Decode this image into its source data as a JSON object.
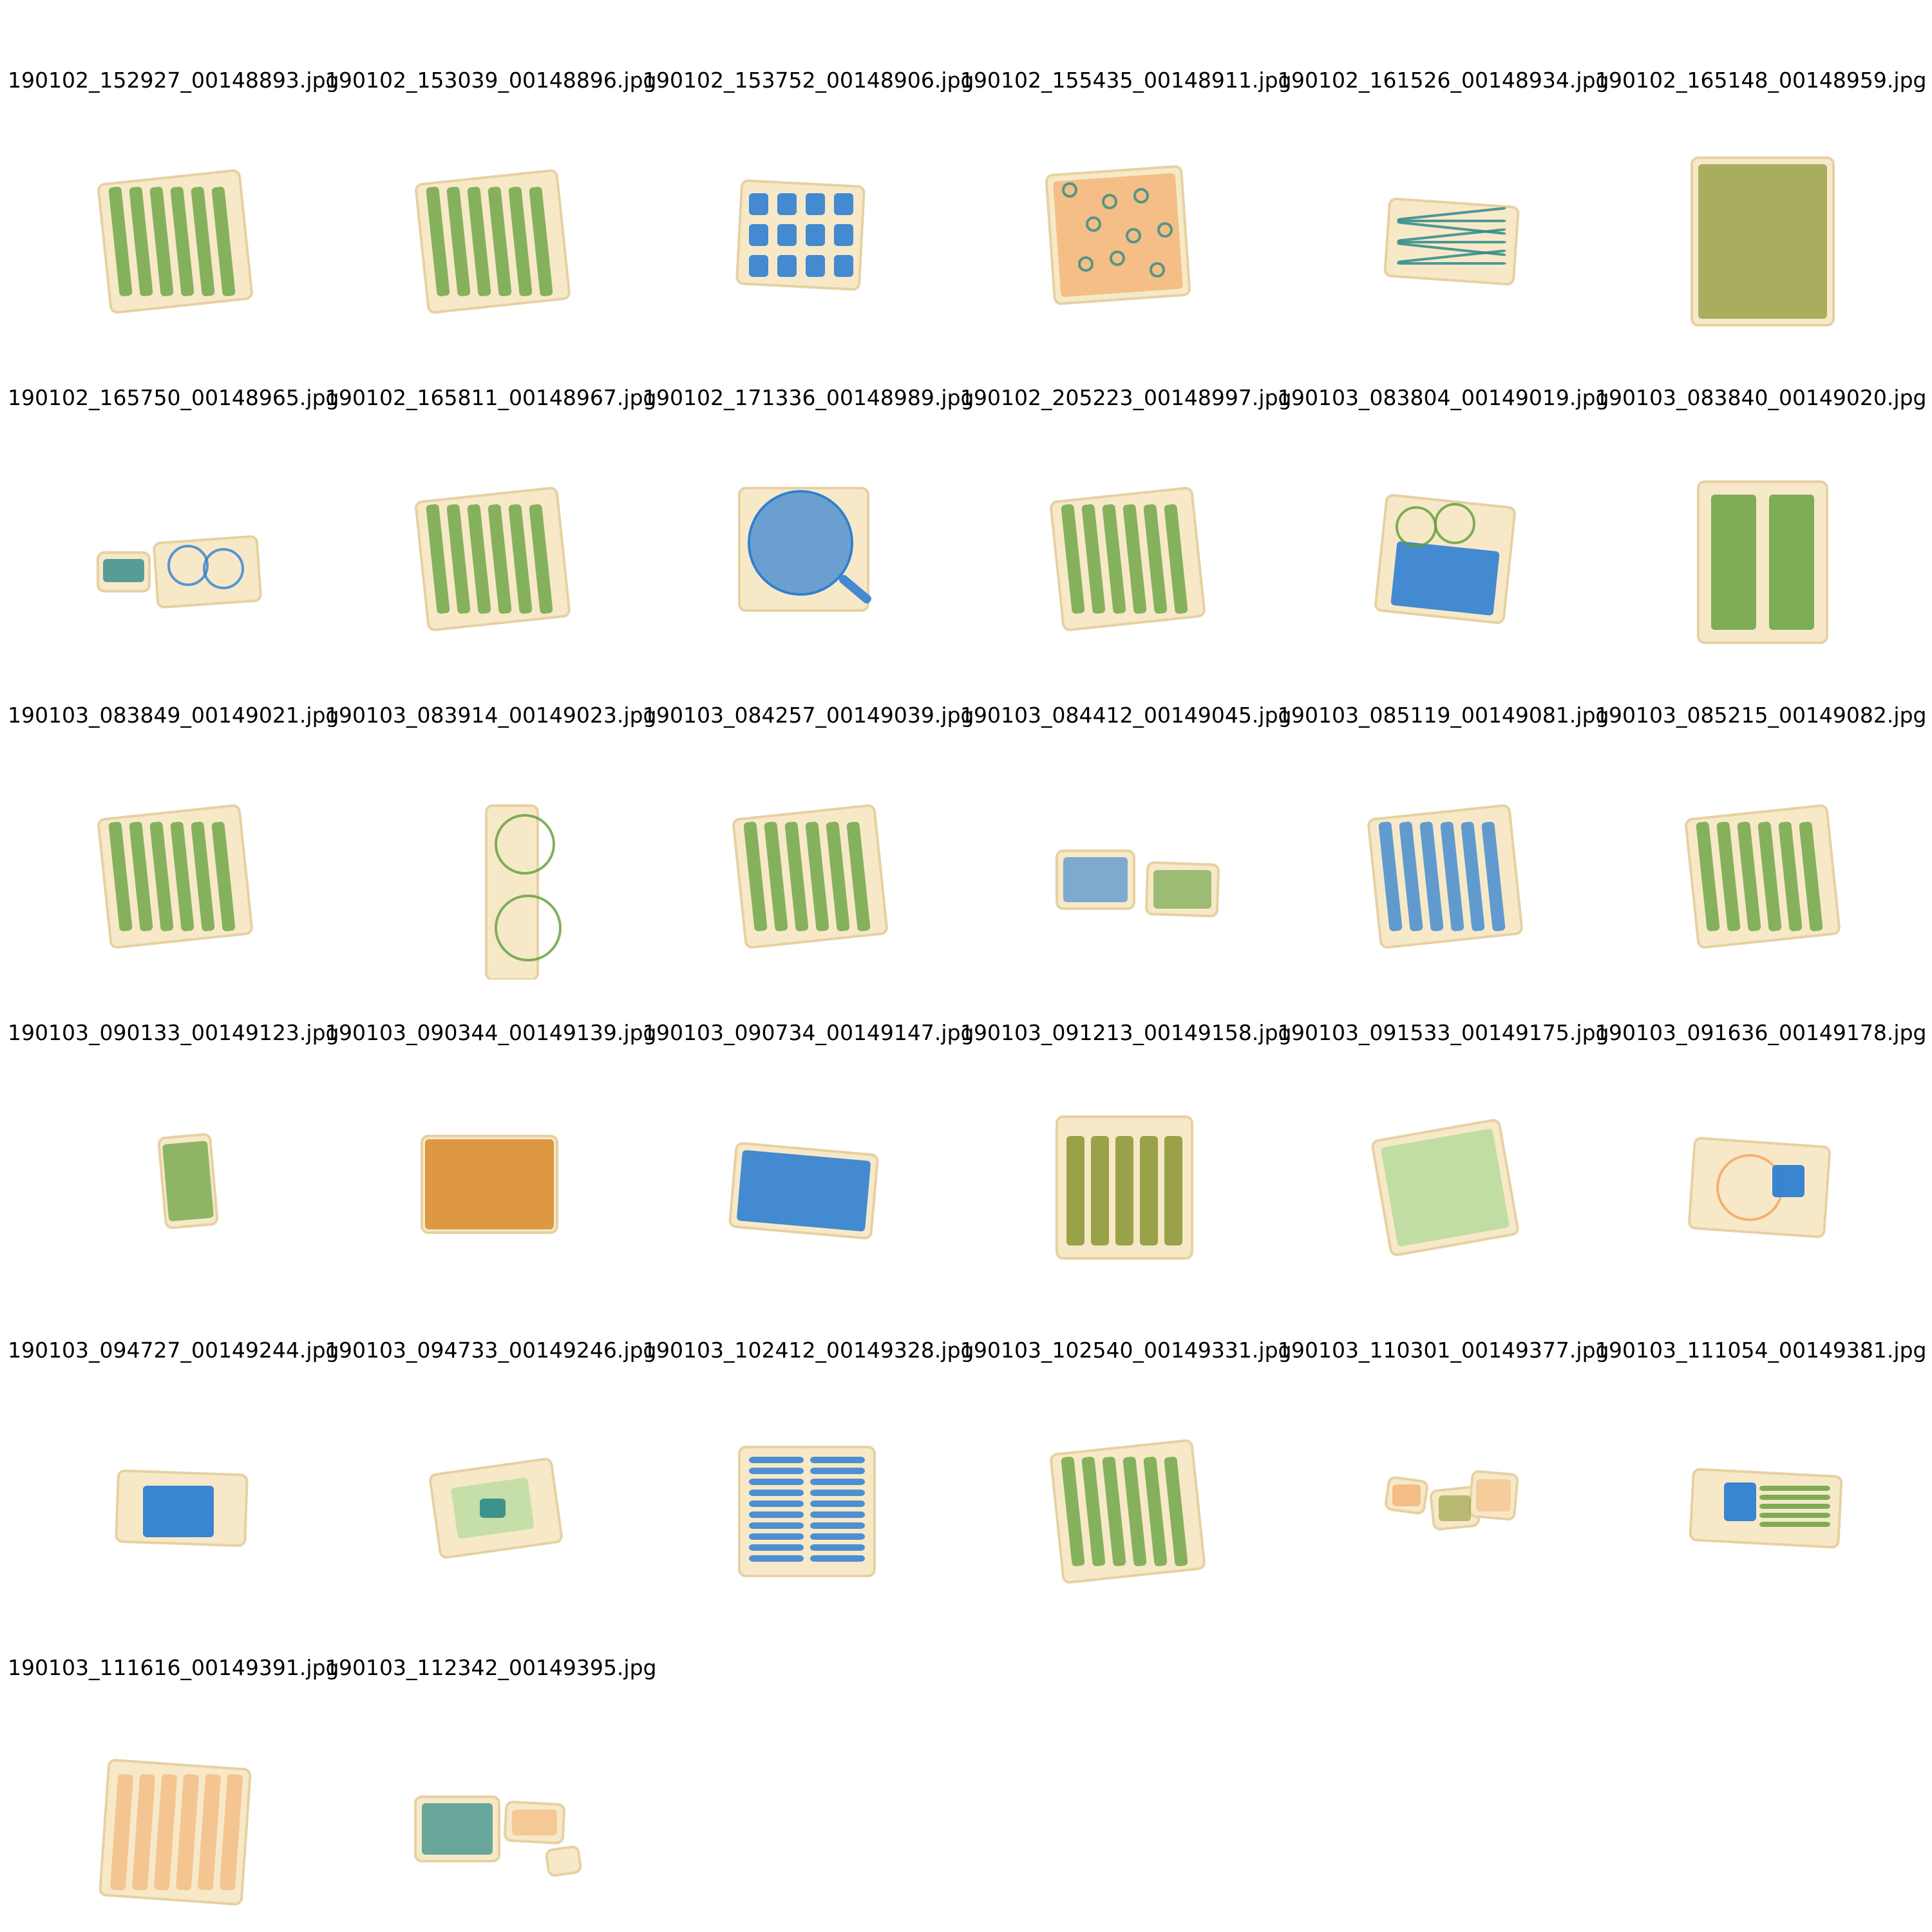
{
  "images": [
    {
      "filename": "190102_152927_00148893.jpg",
      "icon": "xray-bag-green-rows"
    },
    {
      "filename": "190102_153039_00148896.jpg",
      "icon": "xray-bag-green-stripes"
    },
    {
      "filename": "190102_153752_00148906.jpg",
      "icon": "xray-bag-blue-bottles"
    },
    {
      "filename": "190102_155435_00148911.jpg",
      "icon": "xray-bag-orange-rings"
    },
    {
      "filename": "190102_161526_00148934.jpg",
      "icon": "xray-bag-wires"
    },
    {
      "filename": "190102_165148_00148959.jpg",
      "icon": "xray-bag-olive-dense"
    },
    {
      "filename": "190102_165750_00148965.jpg",
      "icon": "xray-bag-coils"
    },
    {
      "filename": "190102_165811_00148967.jpg",
      "icon": "xray-bag-green-dense"
    },
    {
      "filename": "190102_171336_00148989.jpg",
      "icon": "xray-bag-pan"
    },
    {
      "filename": "190102_205223_00148997.jpg",
      "icon": "xray-bag-green-columns"
    },
    {
      "filename": "190103_083804_00149019.jpg",
      "icon": "xray-bag-blue-device"
    },
    {
      "filename": "190103_083840_00149020.jpg",
      "icon": "xray-bag-two-columns"
    },
    {
      "filename": "190103_083849_00149021.jpg",
      "icon": "xray-bag-green-scatter"
    },
    {
      "filename": "190103_083914_00149023.jpg",
      "icon": "xray-bag-partial-ovals"
    },
    {
      "filename": "190103_084257_00149039.jpg",
      "icon": "xray-bag-tilted-green"
    },
    {
      "filename": "190103_084412_00149045.jpg",
      "icon": "xray-bag-two-small"
    },
    {
      "filename": "190103_085119_00149081.jpg",
      "icon": "xray-bag-blue-columns"
    },
    {
      "filename": "190103_085215_00149082.jpg",
      "icon": "xray-bag-tilted-rows"
    },
    {
      "filename": "190103_090133_00149123.jpg",
      "icon": "xray-bag-cropped"
    },
    {
      "filename": "190103_090344_00149139.jpg",
      "icon": "xray-bag-orange-block"
    },
    {
      "filename": "190103_090734_00149147.jpg",
      "icon": "xray-bag-blue-laptop"
    },
    {
      "filename": "190103_091213_00149158.jpg",
      "icon": "xray-bag-olive-bars"
    },
    {
      "filename": "190103_091533_00149175.jpg",
      "icon": "xray-bag-pale-panel"
    },
    {
      "filename": "190103_091636_00149178.jpg",
      "icon": "xray-bag-blue-square"
    },
    {
      "filename": "190103_094727_00149244.jpg",
      "icon": "xray-bag-blue-box"
    },
    {
      "filename": "190103_094733_00149246.jpg",
      "icon": "xray-bag-open-tray"
    },
    {
      "filename": "190103_102412_00149328.jpg",
      "icon": "xray-bag-blue-stacks"
    },
    {
      "filename": "190103_102540_00149331.jpg",
      "icon": "xray-bag-green-cables"
    },
    {
      "filename": "190103_110301_00149377.jpg",
      "icon": "xray-bag-three-small"
    },
    {
      "filename": "190103_111054_00149381.jpg",
      "icon": "xray-bag-blue-tool"
    },
    {
      "filename": "190103_111616_00149391.jpg",
      "icon": "xray-bag-orange-columns"
    },
    {
      "filename": "190103_112342_00149395.jpg",
      "icon": "xray-bag-mixed-small"
    }
  ],
  "colors": {
    "tray": "#f7e9c8",
    "orange": "#f2a25a",
    "green": "#5f9e3a",
    "olive": "#8e9a3a",
    "blue": "#2f7fd1",
    "teal": "#2e8a88",
    "pale_green": "#b9dca0"
  }
}
